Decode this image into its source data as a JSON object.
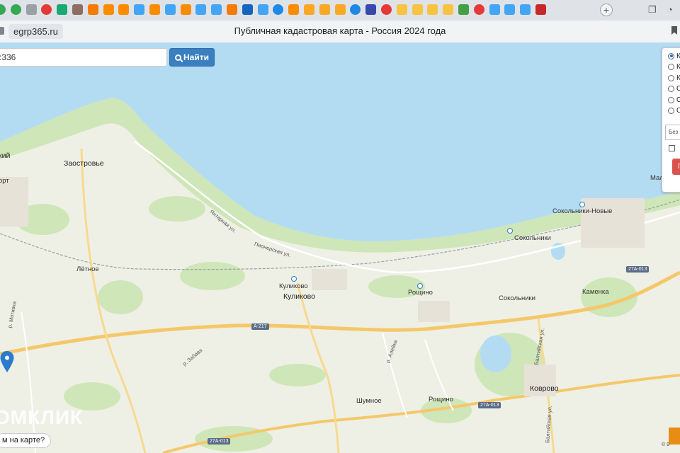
{
  "browser": {
    "domain": "egrp365.ru",
    "page_title": "Публичная кадастровая карта - Россия 2024 года",
    "new_tab_symbol": "+",
    "tab_icons": [
      "check-icon",
      "check-icon",
      "document-icon",
      "yandex-icon",
      "gift-icon",
      "diamond-icon",
      "mail-icon",
      "chart-icon",
      "chart-icon",
      "multicolor-icon",
      "chart-icon",
      "multicolor-icon",
      "chart-icon",
      "multicolor-icon",
      "multicolor-icon",
      "mail-icon",
      "arrow-icon",
      "multicolor-icon",
      "cloud-icon",
      "chart-icon",
      "envelope-icon",
      "envelope-icon",
      "envelope-icon",
      "cloud-icon",
      "cube-icon",
      "yandex-icon",
      "pro-icon",
      "pro-icon",
      "pro-icon",
      "pro-icon",
      "triangle-icon",
      "pin-icon",
      "multicolor-icon",
      "multicolor-icon",
      "multicolor-icon",
      "umbrella-icon"
    ]
  },
  "search": {
    "value": ":336",
    "button_label": "Найти"
  },
  "panel": {
    "radio_labels": [
      "К",
      "К",
      "К",
      "С",
      "С",
      "С"
    ],
    "selected_index": 0,
    "select_value": "Без",
    "button_label": "П"
  },
  "map": {
    "water_color": "#b3dcf3",
    "land_color": "#eef0e6",
    "green_color": "#cfe6b8",
    "road_color": "#f4c86a",
    "labels": {
      "zaostrovye": "Заостровье",
      "kiy": "кий",
      "ort": "орт",
      "letnoe": "Лётное",
      "kulikovo_station": "Куликово",
      "kulikovo": "Куликово",
      "roshchino_station": "Рощино",
      "roshchino": "Рощино",
      "sokolniki_novye": "Сокольники-Новые",
      "sokolniki_station": "Сокольники",
      "sokolniki": "Сокольники",
      "kamenka": "Каменка",
      "kovrovo": "Коврово",
      "shumnoe": "Шумное",
      "mal": "Мал",
      "yantarnaya": "Янтарная ул.",
      "pionerskaya": "Пионерская ул.",
      "zabava": "р. Забава",
      "motivka": "р. Мотивка",
      "alejka": "р. Алейка",
      "baltiyskaya": "Балтийская ул.",
      "baltiyskaya2": "Балтийская ул."
    },
    "shields": {
      "a217": "А-217",
      "r27a013_east": "27А-013",
      "r27a013_mid": "27А-013",
      "r27a013_sw": "27А-013"
    },
    "watermark": "ОМКЛИК",
    "help_button": "м на карте?",
    "copyright": "© 9"
  }
}
